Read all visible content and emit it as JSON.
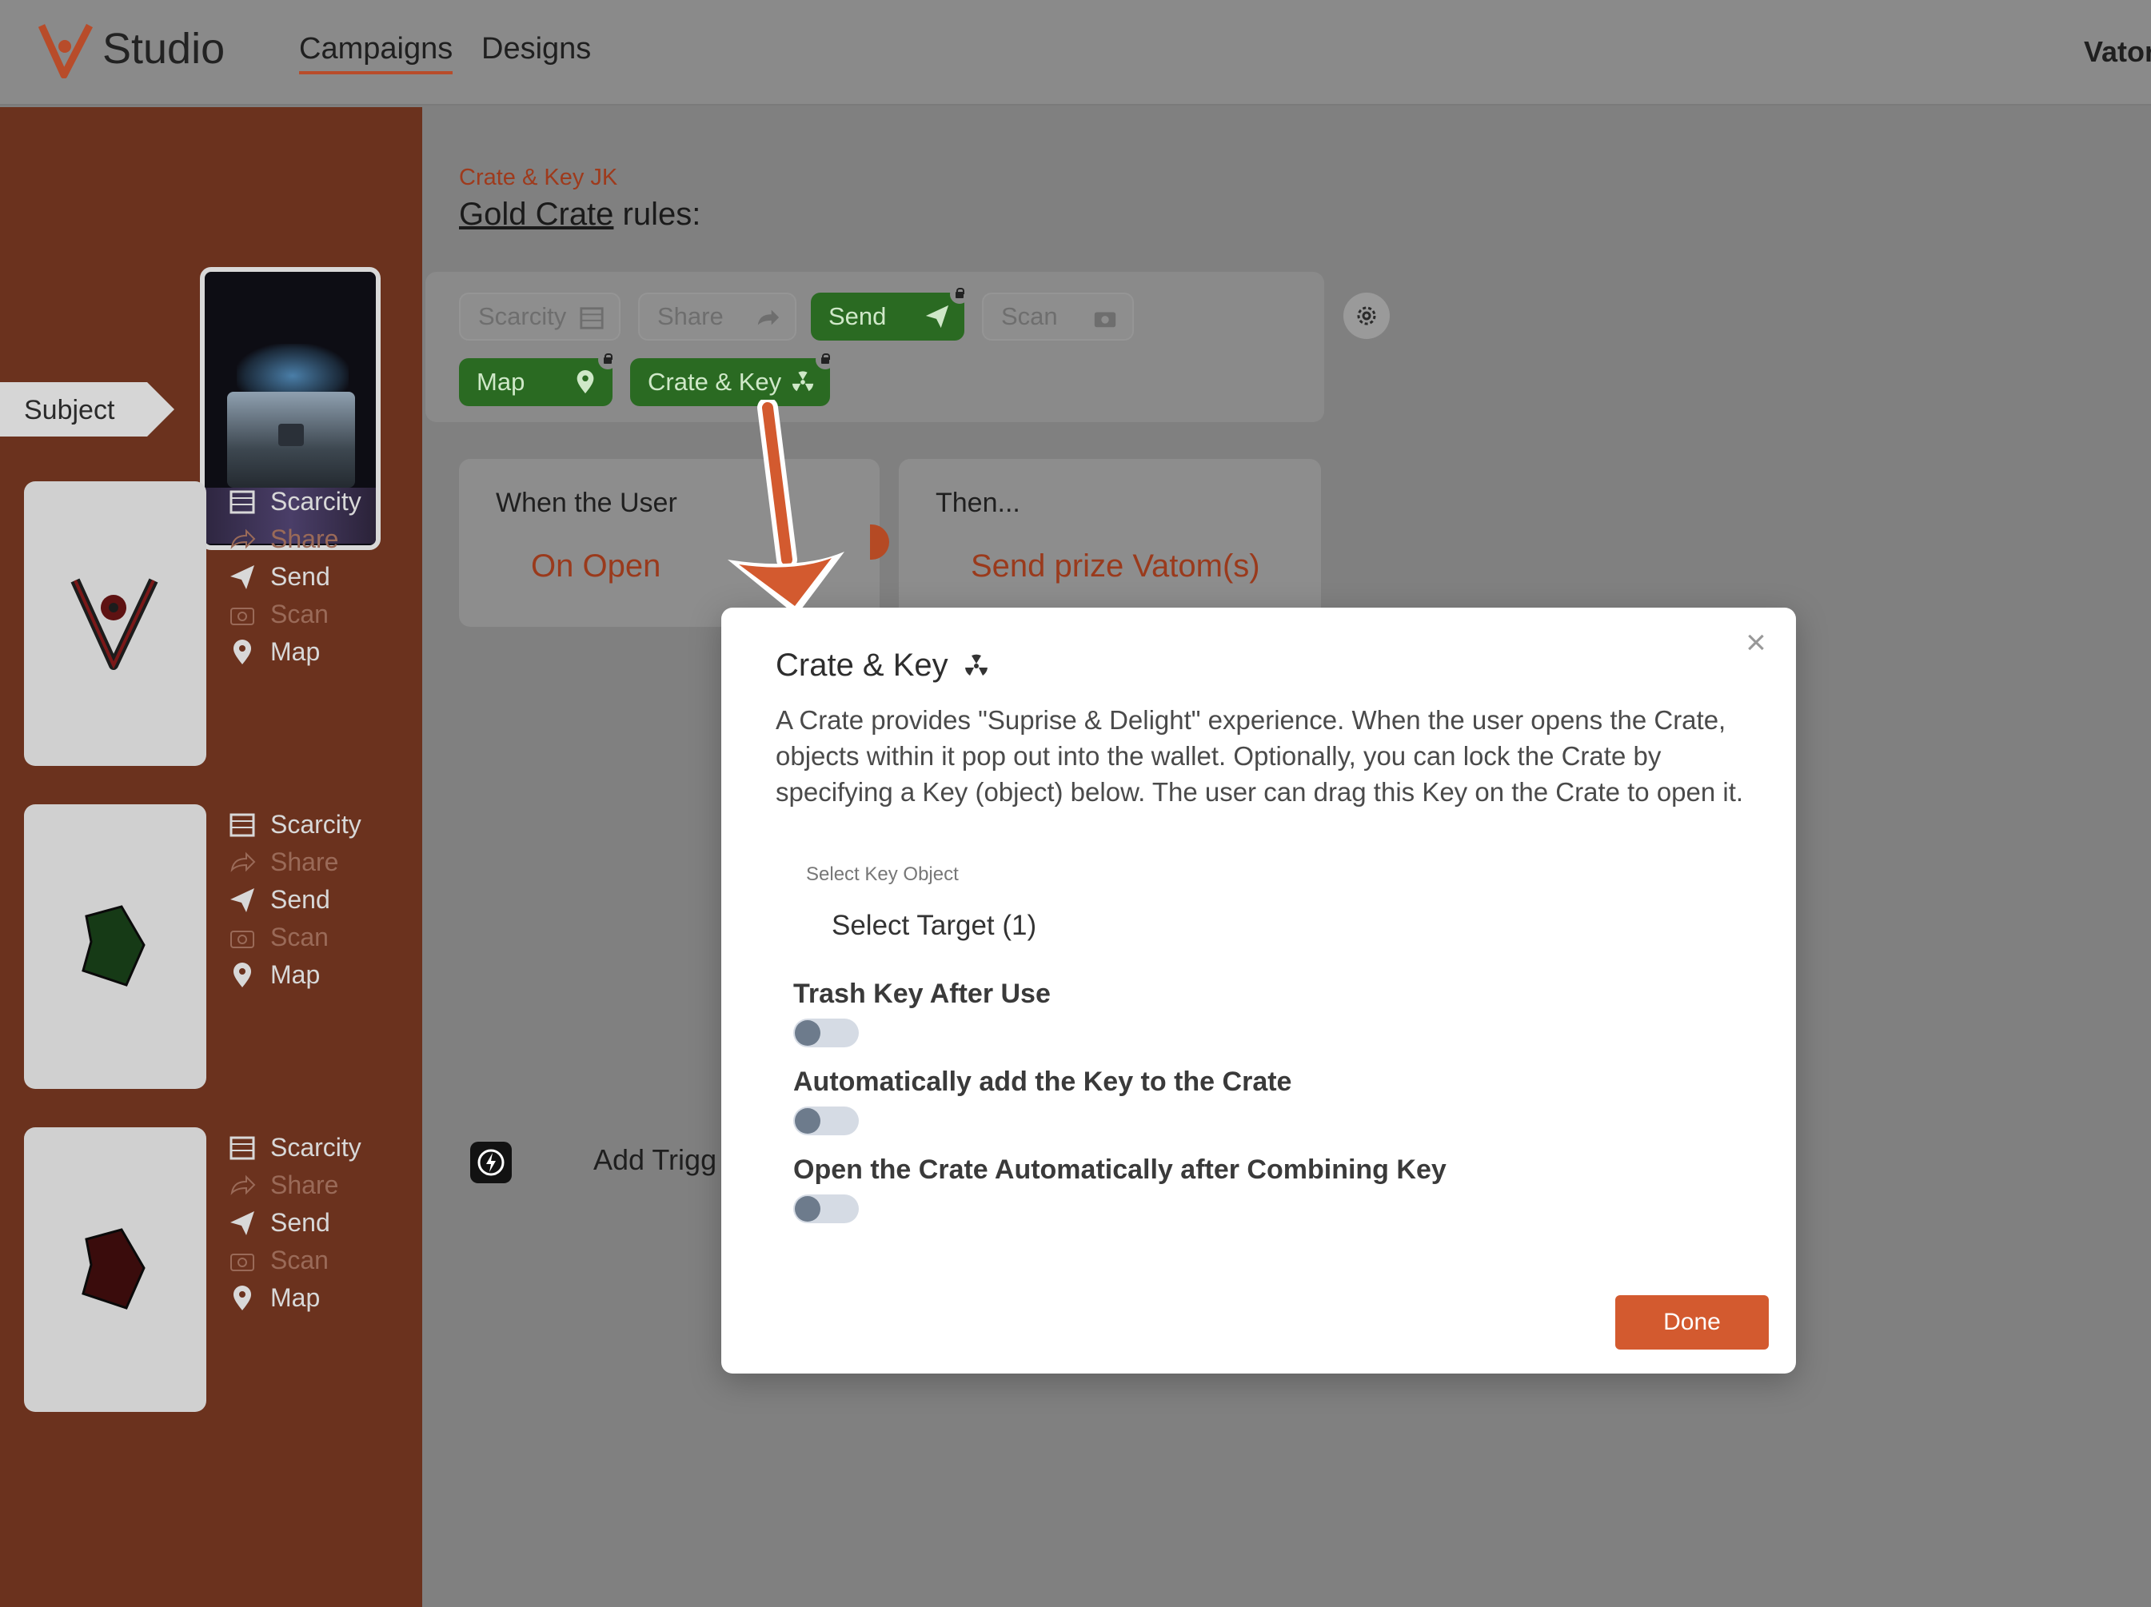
{
  "nav": {
    "brand": "Studio",
    "links": [
      "Campaigns",
      "Designs"
    ],
    "user": "Vator"
  },
  "sidebar": {
    "subject_tab": "Subject",
    "cards": [
      {
        "actions": [
          "Scarcity",
          "Share",
          "Send",
          "Scan",
          "Map"
        ]
      },
      {
        "actions": [
          "Scarcity",
          "Share",
          "Send",
          "Scan",
          "Map"
        ]
      },
      {
        "actions": [
          "Scarcity",
          "Share",
          "Send",
          "Scan",
          "Map"
        ]
      }
    ]
  },
  "main": {
    "breadcrumb": "Crate & Key JK",
    "heading_link": "Gold Crate",
    "heading_rest": " rules:",
    "pills": [
      "Scarcity",
      "Share",
      "Send",
      "Scan",
      "Map",
      "Crate & Key"
    ],
    "rule_when_label": "When the User",
    "rule_when_value": "On Open",
    "rule_then_label": "Then...",
    "rule_then_value": "Send prize Vatom(s)",
    "add_trigger": "Add Trigg"
  },
  "modal": {
    "title": "Crate & Key",
    "description": "A Crate provides \"Suprise & Delight\" experience. When the user opens the Crate, objects within it pop out into the wallet. Optionally, you can lock the Crate by specifying a Key (object) below. The user can drag this Key on the Crate to open it.",
    "select_label": "Select Key Object",
    "select_target": "Select Target (1)",
    "options": [
      "Trash Key After Use",
      "Automatically add the Key to the Crate",
      "Open the Crate Automatically after Combining Key"
    ],
    "done_label": "Done",
    "close_glyph": "×"
  },
  "colors": {
    "accent": "#d35a2f",
    "sidebar": "#6b321e",
    "pill_active": "#2a6a22"
  }
}
